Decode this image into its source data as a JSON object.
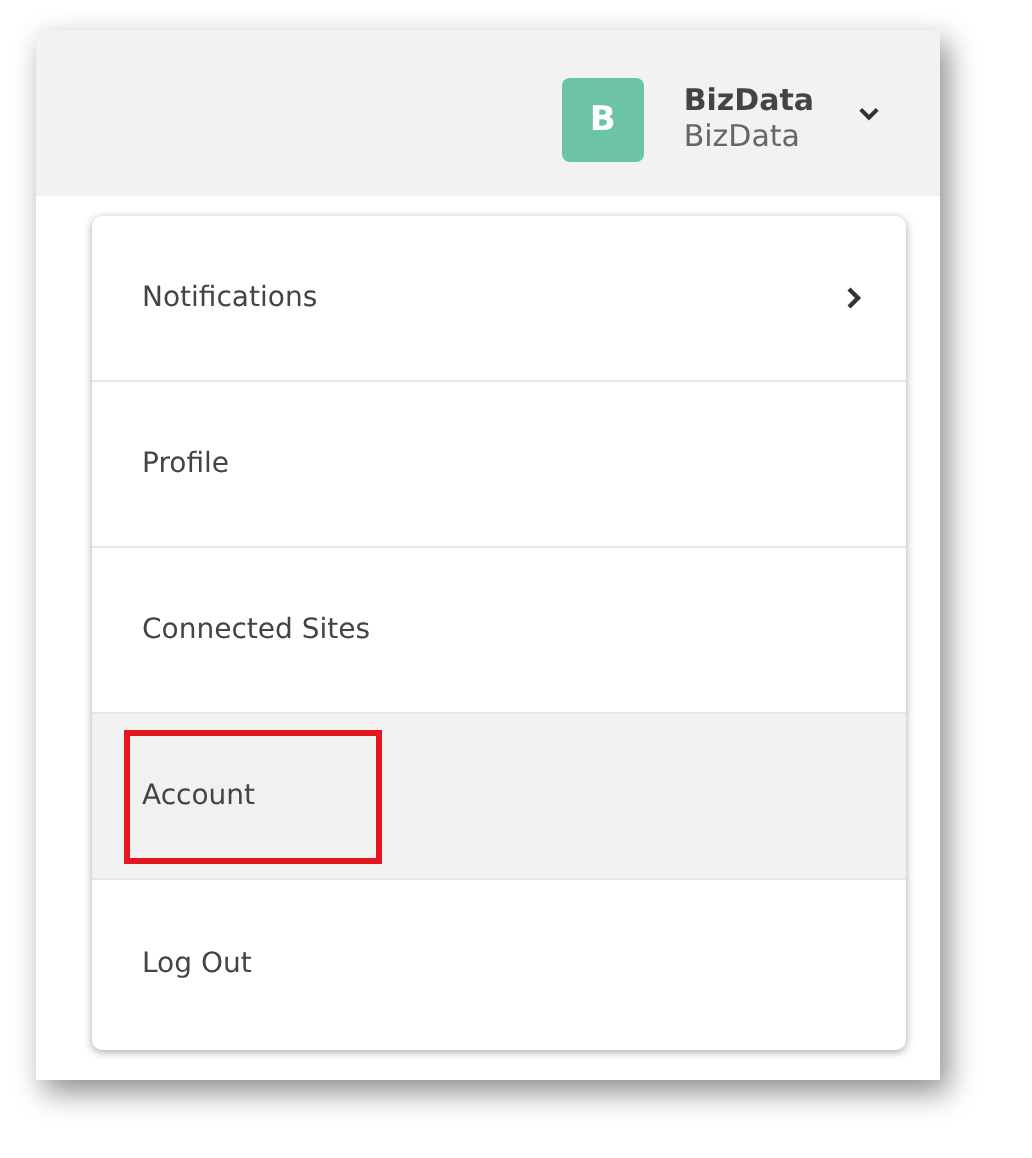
{
  "header": {
    "avatar_letter": "B",
    "user_name": "BizData",
    "org_name": "BizData"
  },
  "menu": [
    {
      "label": "Notifications",
      "kind": "submenu",
      "selected": false,
      "highlighted": false
    },
    {
      "label": "Profile",
      "kind": "link",
      "selected": false,
      "highlighted": false
    },
    {
      "label": "Connected Sites",
      "kind": "link",
      "selected": false,
      "highlighted": false
    },
    {
      "label": "Account",
      "kind": "link",
      "selected": true,
      "highlighted": true
    },
    {
      "label": "Log Out",
      "kind": "link",
      "selected": false,
      "highlighted": false
    }
  ]
}
